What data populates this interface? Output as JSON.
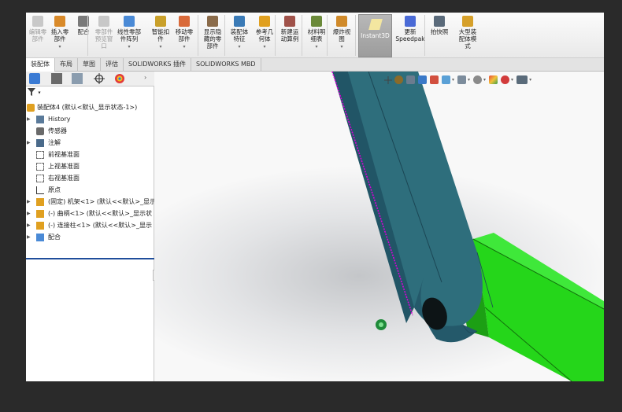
{
  "ribbon": {
    "buttons": [
      {
        "label": "编辑零\n部件",
        "disabled": true
      },
      {
        "label": "插入零\n部件"
      },
      {
        "label": "配合"
      },
      {
        "label": "零部件\n预览窗\n口",
        "disabled": true
      },
      {
        "label": "线性零部\n件阵列"
      },
      {
        "label": "智能扣\n件"
      },
      {
        "label": "移动零\n部件"
      },
      {
        "label": "显示隐\n藏的零\n部件"
      },
      {
        "label": "装配体\n特征"
      },
      {
        "label": "参考几\n何体"
      },
      {
        "label": "新建运\n动算例"
      },
      {
        "label": "材料明\n细表"
      },
      {
        "label": "爆炸视\n图"
      },
      {
        "label": "Instant3D"
      },
      {
        "label": "更新\nSpeedpak"
      },
      {
        "label": "拍快照"
      },
      {
        "label": "大型装\n配体模\n式"
      }
    ]
  },
  "tabs": [
    "装配体",
    "布局",
    "草图",
    "评估",
    "SOLIDWORKS 插件",
    "SOLIDWORKS MBD"
  ],
  "panel": {
    "filter_label": "▾",
    "root": "装配体4 (默认<默认_显示状态-1>)",
    "items": [
      {
        "label": "History",
        "expandable": true,
        "icon": "history-icon"
      },
      {
        "label": "传感器",
        "icon": "sensor-icon"
      },
      {
        "label": "注解",
        "expandable": true,
        "icon": "annotation-icon"
      },
      {
        "label": "前视基准面",
        "icon": "plane-icon"
      },
      {
        "label": "上视基准面",
        "icon": "plane-icon"
      },
      {
        "label": "右视基准面",
        "icon": "plane-icon"
      },
      {
        "label": "原点",
        "icon": "origin-icon"
      },
      {
        "label": "(固定) 机架<1> (默认<<默认>_显示",
        "expandable": true,
        "icon": "part-icon"
      },
      {
        "label": "(-) 曲柄<1> (默认<<默认>_显示状",
        "expandable": true,
        "icon": "part-icon"
      },
      {
        "label": "(-) 连接柱<1> (默认<<默认>_显示",
        "expandable": true,
        "icon": "part-icon"
      },
      {
        "label": "配合",
        "expandable": true,
        "icon": "mates-icon"
      }
    ]
  },
  "colors": {
    "link_face": "#2e6e7c",
    "link_side": "#24596a",
    "green_part": "#25d61a",
    "edge_highlight": "#d800d8",
    "ribbon_bg": "#f3f3f3"
  }
}
